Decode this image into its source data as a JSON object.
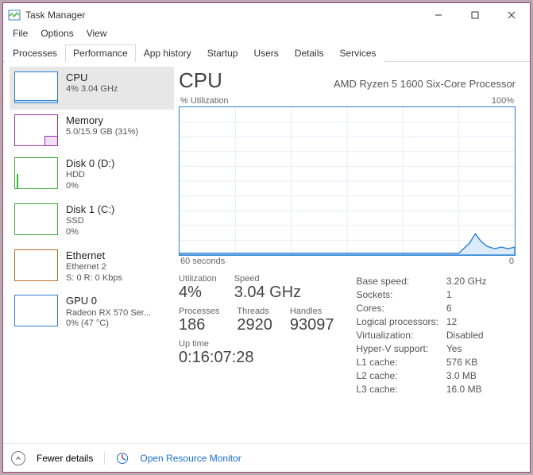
{
  "window": {
    "title": "Task Manager",
    "menu": [
      "File",
      "Options",
      "View"
    ]
  },
  "tabs": [
    "Processes",
    "Performance",
    "App history",
    "Startup",
    "Users",
    "Details",
    "Services"
  ],
  "active_tab_index": 1,
  "sidebar": [
    {
      "title": "CPU",
      "sub": "4%  3.04 GHz",
      "sub2": "",
      "color": "#2a7fd3"
    },
    {
      "title": "Memory",
      "sub": "5.0/15.9 GB (31%)",
      "sub2": "",
      "color": "#9b2fae"
    },
    {
      "title": "Disk 0 (D:)",
      "sub": "HDD",
      "sub2": "0%",
      "color": "#3fae3f"
    },
    {
      "title": "Disk 1 (C:)",
      "sub": "SSD",
      "sub2": "0%",
      "color": "#3fae3f"
    },
    {
      "title": "Ethernet",
      "sub": "Ethernet 2",
      "sub2": "S: 0 R: 0 Kbps",
      "color": "#c06a2b"
    },
    {
      "title": "GPU 0",
      "sub": "Radeon RX 570 Ser...",
      "sub2": "0%  (47 °C)",
      "color": "#2a7fd3"
    }
  ],
  "main": {
    "heading": "CPU",
    "model": "AMD Ryzen 5 1600 Six-Core Processor",
    "chart_top_left": "% Utilization",
    "chart_top_right": "100%",
    "chart_bottom_left": "60 seconds",
    "chart_bottom_right": "0"
  },
  "chart_data": {
    "type": "area",
    "x_seconds": [
      60,
      55,
      50,
      45,
      40,
      35,
      30,
      25,
      20,
      15,
      10,
      8,
      6,
      5,
      4,
      3,
      2,
      1,
      0
    ],
    "utilization_pct": [
      1,
      1,
      1,
      1,
      1,
      1,
      1,
      1,
      1,
      1,
      2,
      8,
      14,
      9,
      6,
      4,
      5,
      4,
      5
    ],
    "ylim": [
      0,
      100
    ],
    "ylabel": "% Utilization",
    "xlabel": "seconds"
  },
  "stats_left": {
    "utilization_label": "Utilization",
    "utilization": "4%",
    "speed_label": "Speed",
    "speed": "3.04 GHz",
    "processes_label": "Processes",
    "processes": "186",
    "threads_label": "Threads",
    "threads": "2920",
    "handles_label": "Handles",
    "handles": "93097",
    "uptime_label": "Up time",
    "uptime": "0:16:07:28"
  },
  "stats_right": {
    "base_speed_k": "Base speed:",
    "base_speed_v": "3.20 GHz",
    "sockets_k": "Sockets:",
    "sockets_v": "1",
    "cores_k": "Cores:",
    "cores_v": "6",
    "lprocs_k": "Logical processors:",
    "lprocs_v": "12",
    "virt_k": "Virtualization:",
    "virt_v": "Disabled",
    "hyperv_k": "Hyper-V support:",
    "hyperv_v": "Yes",
    "l1_k": "L1 cache:",
    "l1_v": "576 KB",
    "l2_k": "L2 cache:",
    "l2_v": "3.0 MB",
    "l3_k": "L3 cache:",
    "l3_v": "16.0 MB"
  },
  "footer": {
    "fewer": "Fewer details",
    "orm": "Open Resource Monitor"
  }
}
